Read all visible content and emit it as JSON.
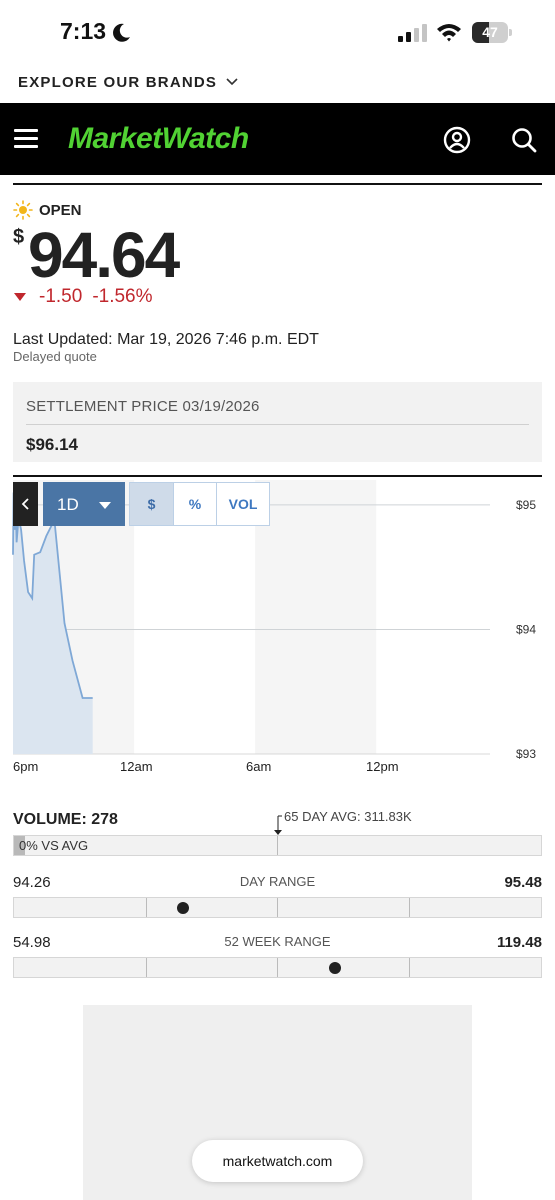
{
  "status_bar": {
    "time": "7:13",
    "battery_percent": "47",
    "battery_level": 0.47
  },
  "explore_brands": {
    "label": "EXPLORE OUR BRANDS"
  },
  "header": {
    "logo": "MarketWatch",
    "logo_color": "#51d233",
    "background": "#000000"
  },
  "quote": {
    "market_state": "OPEN",
    "currency": "$",
    "price": "94.64",
    "change": "-1.50",
    "change_percent": "-1.56%",
    "negative_color": "#c0272d",
    "last_updated": "Last Updated: Mar 19, 2026 7:46 p.m. EDT",
    "delayed": "Delayed quote"
  },
  "settlement": {
    "label": "SETTLEMENT PRICE 03/19/2026",
    "value": "$96.14"
  },
  "chart_controls": {
    "period": "1D",
    "toggles": [
      {
        "label": "$",
        "active": true
      },
      {
        "label": "%",
        "active": false
      },
      {
        "label": "VOL",
        "active": false
      }
    ],
    "accent": "#4a75a5"
  },
  "chart_data": {
    "type": "area",
    "x_tick_labels": [
      "6pm",
      "12am",
      "6am",
      "12pm"
    ],
    "y_tick_labels": [
      "$95",
      "$94",
      "$93"
    ],
    "ylim": [
      93,
      95.2
    ],
    "y_ticks": [
      93,
      94,
      95
    ],
    "x_range_hours": [
      0,
      24
    ],
    "x_tick_hours": [
      0,
      6,
      12,
      18
    ],
    "shaded_bands_hours": [
      [
        0,
        6
      ],
      [
        12,
        18
      ]
    ],
    "series": [
      {
        "x_hours": [
          0,
          0.03,
          0.08,
          0.13,
          0.18,
          0.28,
          0.4,
          0.55,
          0.75,
          0.95,
          1.05,
          1.35,
          1.65,
          2.05,
          2.55,
          2.95,
          3.45,
          3.95
        ],
        "values": [
          94.6,
          95.1,
          94.8,
          95.05,
          94.7,
          94.9,
          94.8,
          94.55,
          94.3,
          94.25,
          94.6,
          94.62,
          94.75,
          94.88,
          94.05,
          93.75,
          93.45,
          93.45
        ]
      }
    ],
    "line_color": "#7fa8d6",
    "fill_color": "#dbe5f0",
    "grid": true
  },
  "volume": {
    "label": "VOLUME: 278",
    "avg_label": "65 DAY AVG: 311.83K",
    "vs_avg_text": "0% VS AVG",
    "fill_fraction": 0.02
  },
  "day_range": {
    "low": "94.26",
    "title": "DAY RANGE",
    "high": "95.48",
    "position": 0.32
  },
  "week52_range": {
    "low": "54.98",
    "title": "52 WEEK RANGE",
    "high": "119.48",
    "position": 0.61
  },
  "browser": {
    "url": "marketwatch.com"
  }
}
